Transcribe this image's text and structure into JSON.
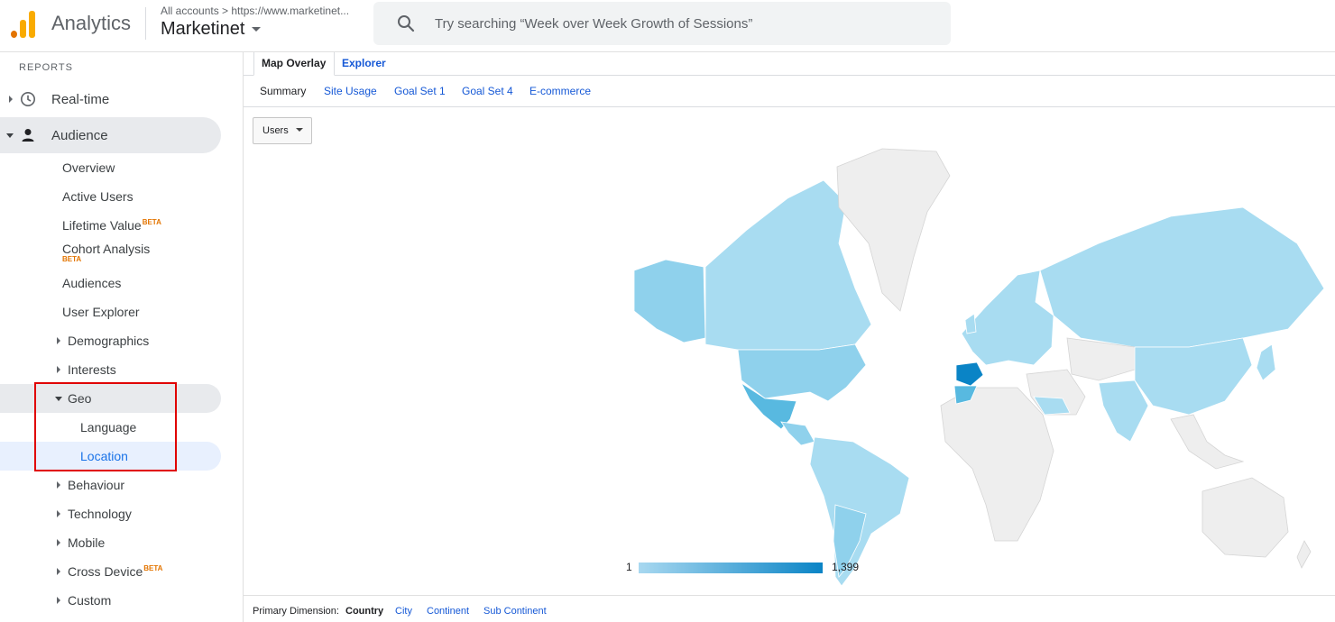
{
  "header": {
    "app_name": "Analytics",
    "account_path": "All accounts > https://www.marketinet...",
    "account_name": "Marketinet",
    "search_placeholder": "Try searching “Week over Week Growth of Sessions”"
  },
  "sidebar": {
    "section_label": "REPORTS",
    "realtime": "Real-time",
    "audience": "Audience",
    "overview": "Overview",
    "active_users": "Active Users",
    "lifetime_value": "Lifetime Value",
    "cohort_analysis": "Cohort Analysis",
    "audiences": "Audiences",
    "user_explorer": "User Explorer",
    "demographics": "Demographics",
    "interests": "Interests",
    "geo": "Geo",
    "language": "Language",
    "location": "Location",
    "behaviour": "Behaviour",
    "technology": "Technology",
    "mobile": "Mobile",
    "cross_device": "Cross Device",
    "custom": "Custom",
    "beta": "BETA"
  },
  "main": {
    "tabs": [
      "Map Overlay",
      "Explorer"
    ],
    "subtabs": [
      "Summary",
      "Site Usage",
      "Goal Set 1",
      "Goal Set 4",
      "E-commerce"
    ],
    "metric_selector": "Users",
    "legend_min": "1",
    "legend_max": "1,399",
    "primary_dimension_label": "Primary Dimension:",
    "dimensions": [
      "Country",
      "City",
      "Continent",
      "Sub Continent"
    ]
  },
  "colors": {
    "accent": "#1a73e8",
    "link": "#1558d6",
    "map_light": "#a8d8f0",
    "map_dark": "#0a84c6",
    "highlight_box": "#e00000"
  }
}
